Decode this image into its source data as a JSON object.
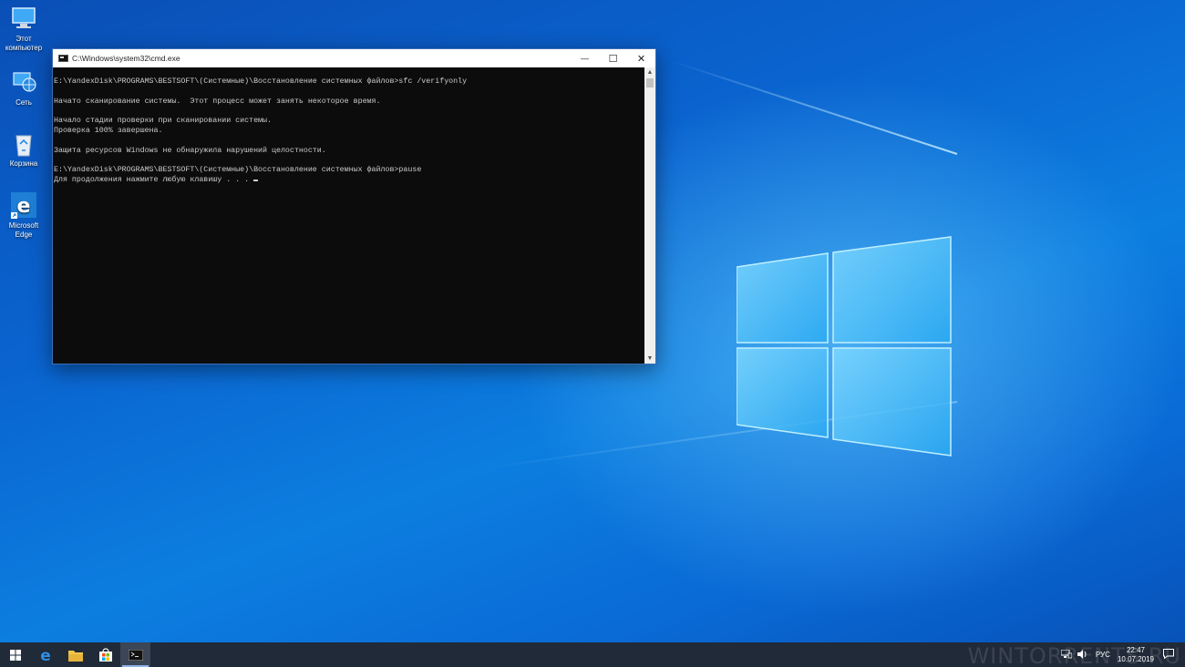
{
  "desktop": {
    "icons": [
      {
        "label_1": "Этот",
        "label_2": "компьютер",
        "icon": "this-pc-icon"
      },
      {
        "label_1": "Сеть",
        "icon": "network-icon"
      },
      {
        "label_1": "Корзина",
        "icon": "recycle-bin-icon"
      },
      {
        "label_1": "Microsoft",
        "label_2": "Edge",
        "icon": "edge-icon"
      }
    ]
  },
  "cmd_window": {
    "title": "C:\\Windows\\system32\\cmd.exe",
    "minimize": "—",
    "maximize": "☐",
    "close": "✕",
    "lines": [
      "",
      "E:\\YandexDisk\\PROGRAMS\\BESTSOFT\\(Системные)\\Восстановление системных файлов>sfc /verifyonly",
      "",
      "Начато сканирование системы.  Этот процесс может занять некоторое время.",
      "",
      "Начало стадии проверки при сканировании системы.",
      "Проверка 100% завершена.",
      "",
      "Защита ресурсов Windows не обнаружила нарушений целостности.",
      "",
      "E:\\YandexDisk\\PROGRAMS\\BESTSOFT\\(Системные)\\Восстановление системных файлов>pause",
      "Для продолжения нажмите любую клавишу . . . "
    ]
  },
  "taskbar": {
    "items": [
      "start-icon",
      "edge-icon",
      "file-explorer-icon",
      "store-icon",
      "cmd-icon"
    ],
    "language": "РУС",
    "time": "22:47",
    "date": "10.07.2019",
    "watermark": "WINTORRENTS.RU"
  }
}
